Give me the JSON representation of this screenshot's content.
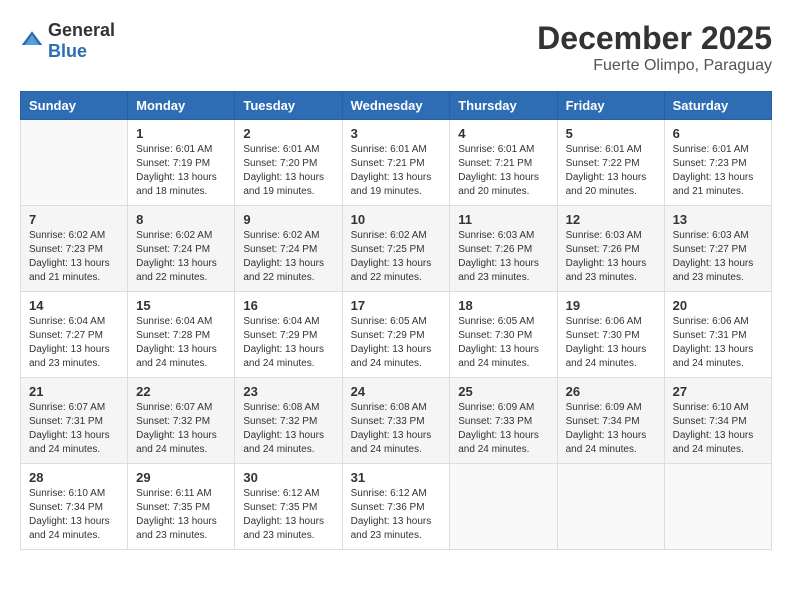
{
  "header": {
    "logo_general": "General",
    "logo_blue": "Blue",
    "month_year": "December 2025",
    "location": "Fuerte Olimpo, Paraguay"
  },
  "weekdays": [
    "Sunday",
    "Monday",
    "Tuesday",
    "Wednesday",
    "Thursday",
    "Friday",
    "Saturday"
  ],
  "weeks": [
    [
      {
        "day": "",
        "sunrise": "",
        "sunset": "",
        "daylight": "",
        "empty": true
      },
      {
        "day": "1",
        "sunrise": "Sunrise: 6:01 AM",
        "sunset": "Sunset: 7:19 PM",
        "daylight": "Daylight: 13 hours and 18 minutes."
      },
      {
        "day": "2",
        "sunrise": "Sunrise: 6:01 AM",
        "sunset": "Sunset: 7:20 PM",
        "daylight": "Daylight: 13 hours and 19 minutes."
      },
      {
        "day": "3",
        "sunrise": "Sunrise: 6:01 AM",
        "sunset": "Sunset: 7:21 PM",
        "daylight": "Daylight: 13 hours and 19 minutes."
      },
      {
        "day": "4",
        "sunrise": "Sunrise: 6:01 AM",
        "sunset": "Sunset: 7:21 PM",
        "daylight": "Daylight: 13 hours and 20 minutes."
      },
      {
        "day": "5",
        "sunrise": "Sunrise: 6:01 AM",
        "sunset": "Sunset: 7:22 PM",
        "daylight": "Daylight: 13 hours and 20 minutes."
      },
      {
        "day": "6",
        "sunrise": "Sunrise: 6:01 AM",
        "sunset": "Sunset: 7:23 PM",
        "daylight": "Daylight: 13 hours and 21 minutes."
      }
    ],
    [
      {
        "day": "7",
        "sunrise": "Sunrise: 6:02 AM",
        "sunset": "Sunset: 7:23 PM",
        "daylight": "Daylight: 13 hours and 21 minutes."
      },
      {
        "day": "8",
        "sunrise": "Sunrise: 6:02 AM",
        "sunset": "Sunset: 7:24 PM",
        "daylight": "Daylight: 13 hours and 22 minutes."
      },
      {
        "day": "9",
        "sunrise": "Sunrise: 6:02 AM",
        "sunset": "Sunset: 7:24 PM",
        "daylight": "Daylight: 13 hours and 22 minutes."
      },
      {
        "day": "10",
        "sunrise": "Sunrise: 6:02 AM",
        "sunset": "Sunset: 7:25 PM",
        "daylight": "Daylight: 13 hours and 22 minutes."
      },
      {
        "day": "11",
        "sunrise": "Sunrise: 6:03 AM",
        "sunset": "Sunset: 7:26 PM",
        "daylight": "Daylight: 13 hours and 23 minutes."
      },
      {
        "day": "12",
        "sunrise": "Sunrise: 6:03 AM",
        "sunset": "Sunset: 7:26 PM",
        "daylight": "Daylight: 13 hours and 23 minutes."
      },
      {
        "day": "13",
        "sunrise": "Sunrise: 6:03 AM",
        "sunset": "Sunset: 7:27 PM",
        "daylight": "Daylight: 13 hours and 23 minutes."
      }
    ],
    [
      {
        "day": "14",
        "sunrise": "Sunrise: 6:04 AM",
        "sunset": "Sunset: 7:27 PM",
        "daylight": "Daylight: 13 hours and 23 minutes."
      },
      {
        "day": "15",
        "sunrise": "Sunrise: 6:04 AM",
        "sunset": "Sunset: 7:28 PM",
        "daylight": "Daylight: 13 hours and 24 minutes."
      },
      {
        "day": "16",
        "sunrise": "Sunrise: 6:04 AM",
        "sunset": "Sunset: 7:29 PM",
        "daylight": "Daylight: 13 hours and 24 minutes."
      },
      {
        "day": "17",
        "sunrise": "Sunrise: 6:05 AM",
        "sunset": "Sunset: 7:29 PM",
        "daylight": "Daylight: 13 hours and 24 minutes."
      },
      {
        "day": "18",
        "sunrise": "Sunrise: 6:05 AM",
        "sunset": "Sunset: 7:30 PM",
        "daylight": "Daylight: 13 hours and 24 minutes."
      },
      {
        "day": "19",
        "sunrise": "Sunrise: 6:06 AM",
        "sunset": "Sunset: 7:30 PM",
        "daylight": "Daylight: 13 hours and 24 minutes."
      },
      {
        "day": "20",
        "sunrise": "Sunrise: 6:06 AM",
        "sunset": "Sunset: 7:31 PM",
        "daylight": "Daylight: 13 hours and 24 minutes."
      }
    ],
    [
      {
        "day": "21",
        "sunrise": "Sunrise: 6:07 AM",
        "sunset": "Sunset: 7:31 PM",
        "daylight": "Daylight: 13 hours and 24 minutes."
      },
      {
        "day": "22",
        "sunrise": "Sunrise: 6:07 AM",
        "sunset": "Sunset: 7:32 PM",
        "daylight": "Daylight: 13 hours and 24 minutes."
      },
      {
        "day": "23",
        "sunrise": "Sunrise: 6:08 AM",
        "sunset": "Sunset: 7:32 PM",
        "daylight": "Daylight: 13 hours and 24 minutes."
      },
      {
        "day": "24",
        "sunrise": "Sunrise: 6:08 AM",
        "sunset": "Sunset: 7:33 PM",
        "daylight": "Daylight: 13 hours and 24 minutes."
      },
      {
        "day": "25",
        "sunrise": "Sunrise: 6:09 AM",
        "sunset": "Sunset: 7:33 PM",
        "daylight": "Daylight: 13 hours and 24 minutes."
      },
      {
        "day": "26",
        "sunrise": "Sunrise: 6:09 AM",
        "sunset": "Sunset: 7:34 PM",
        "daylight": "Daylight: 13 hours and 24 minutes."
      },
      {
        "day": "27",
        "sunrise": "Sunrise: 6:10 AM",
        "sunset": "Sunset: 7:34 PM",
        "daylight": "Daylight: 13 hours and 24 minutes."
      }
    ],
    [
      {
        "day": "28",
        "sunrise": "Sunrise: 6:10 AM",
        "sunset": "Sunset: 7:34 PM",
        "daylight": "Daylight: 13 hours and 24 minutes."
      },
      {
        "day": "29",
        "sunrise": "Sunrise: 6:11 AM",
        "sunset": "Sunset: 7:35 PM",
        "daylight": "Daylight: 13 hours and 23 minutes."
      },
      {
        "day": "30",
        "sunrise": "Sunrise: 6:12 AM",
        "sunset": "Sunset: 7:35 PM",
        "daylight": "Daylight: 13 hours and 23 minutes."
      },
      {
        "day": "31",
        "sunrise": "Sunrise: 6:12 AM",
        "sunset": "Sunset: 7:36 PM",
        "daylight": "Daylight: 13 hours and 23 minutes."
      },
      {
        "day": "",
        "sunrise": "",
        "sunset": "",
        "daylight": "",
        "empty": true
      },
      {
        "day": "",
        "sunrise": "",
        "sunset": "",
        "daylight": "",
        "empty": true
      },
      {
        "day": "",
        "sunrise": "",
        "sunset": "",
        "daylight": "",
        "empty": true
      }
    ]
  ]
}
